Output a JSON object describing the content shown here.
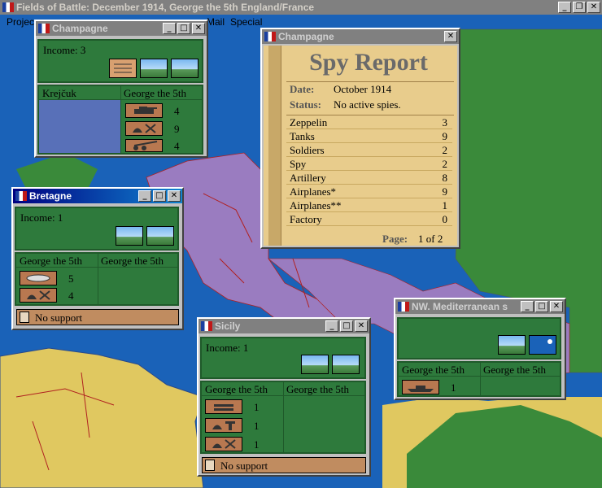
{
  "app": {
    "title": "Fields of Battle: December 1914, George the 5th England/France"
  },
  "menu": [
    "Projec",
    "Mail",
    "Special"
  ],
  "colors": {
    "ocean": "#1a62b8",
    "land_green": "#3a8a3a",
    "land_purple": "#9a7cc0",
    "land_yellow": "#e0c860",
    "window_green": "#2e7a3c"
  },
  "champagne": {
    "title": "Champagne",
    "income": "Income: 3",
    "col_left": "Krejčuk",
    "col_right": "George the 5th",
    "units": [
      {
        "icon": "tank-icon",
        "count": "4"
      },
      {
        "icon": "soldiers-icon",
        "count": "9"
      },
      {
        "icon": "artillery-icon",
        "count": "4"
      }
    ]
  },
  "spy": {
    "window_title": "Champagne",
    "heading": "Spy Report",
    "date_label": "Date:",
    "date": "October 1914",
    "status_label": "Status:",
    "status": "No active spies.",
    "rows": [
      {
        "label": "Zeppelin",
        "value": "3"
      },
      {
        "label": "Tanks",
        "value": "9"
      },
      {
        "label": "Soldiers",
        "value": "2"
      },
      {
        "label": "Spy",
        "value": "2"
      },
      {
        "label": "Artillery",
        "value": "8"
      },
      {
        "label": "Airplanes*",
        "value": "9"
      },
      {
        "label": "Airplanes**",
        "value": "1"
      },
      {
        "label": "Factory",
        "value": "0"
      }
    ],
    "page_label": "Page:",
    "page": "1 of 2"
  },
  "bretagne": {
    "title": "Bretagne",
    "income": "Income: 1",
    "col_left": "George the 5th",
    "col_right": "George the 5th",
    "units": [
      {
        "icon": "zeppelin-icon",
        "count": "5"
      },
      {
        "icon": "soldiers-icon",
        "count": "4"
      }
    ],
    "support": "No support"
  },
  "sicily": {
    "title": "Sicily",
    "income": "Income: 1",
    "col_left": "George the 5th",
    "col_right": "George the 5th",
    "units": [
      {
        "icon": "airplane-icon",
        "count": "1"
      },
      {
        "icon": "spy-icon",
        "count": "1"
      },
      {
        "icon": "soldiers-icon",
        "count": "1"
      }
    ],
    "support": "No support"
  },
  "nwmed": {
    "title": "NW. Mediterranean s",
    "col_left": "George the 5th",
    "col_right": "George the 5th",
    "units": [
      {
        "icon": "battleship-icon",
        "count": "1"
      }
    ]
  }
}
